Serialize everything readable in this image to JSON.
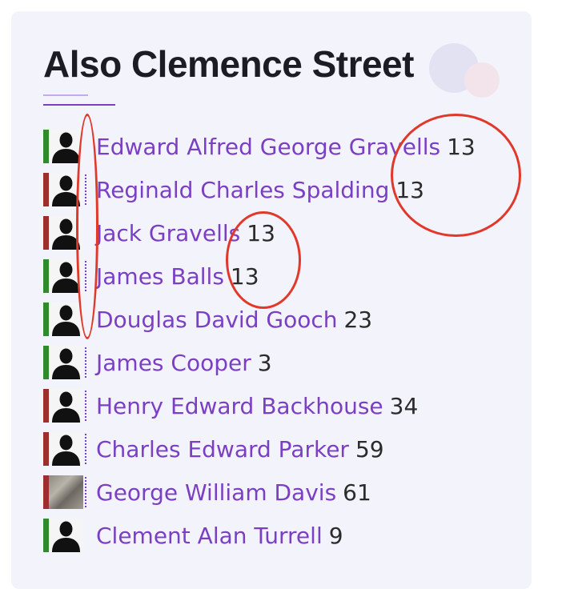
{
  "section": {
    "title": "Also Clemence Street"
  },
  "people": [
    {
      "name": "Edward Alfred George Gravells",
      "count": "13",
      "bar": "green",
      "photo": false,
      "dots": false
    },
    {
      "name": "Reginald Charles Spalding",
      "count": "13",
      "bar": "red",
      "photo": false,
      "dots": true
    },
    {
      "name": "Jack Gravells",
      "count": "13",
      "bar": "red",
      "photo": false,
      "dots": false
    },
    {
      "name": "James Balls",
      "count": "13",
      "bar": "green",
      "photo": false,
      "dots": true
    },
    {
      "name": "Douglas David Gooch",
      "count": "23",
      "bar": "green",
      "photo": false,
      "dots": false
    },
    {
      "name": "James Cooper",
      "count": "3",
      "bar": "green",
      "photo": false,
      "dots": true
    },
    {
      "name": "Henry Edward Backhouse",
      "count": "34",
      "bar": "red",
      "photo": false,
      "dots": true
    },
    {
      "name": "Charles Edward Parker",
      "count": "59",
      "bar": "red",
      "photo": false,
      "dots": true
    },
    {
      "name": "George William Davis",
      "count": "61",
      "bar": "red",
      "photo": true,
      "dots": true
    },
    {
      "name": "Clement Alan Turrell",
      "count": "9",
      "bar": "green",
      "photo": false,
      "dots": false
    }
  ],
  "colors": {
    "accent": "#7b3fc4",
    "bar_green": "#2f8b2b",
    "bar_red": "#9b2e2e",
    "annotation": "#e0392b"
  },
  "icons": {
    "avatar_placeholder": "person-silhouette-icon"
  }
}
